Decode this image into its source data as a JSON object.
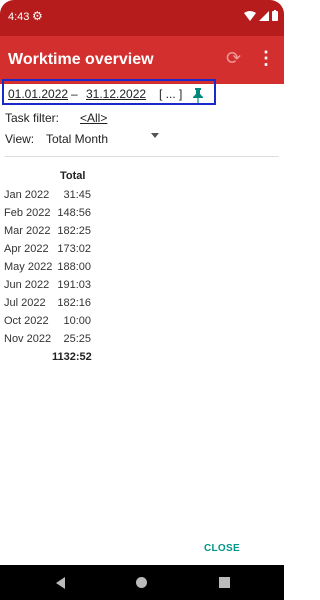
{
  "status": {
    "time": "4:43"
  },
  "appbar": {
    "title": "Worktime overview"
  },
  "date_range": {
    "from": "01.01.2022",
    "separator": "–",
    "to": "31.12.2022",
    "more": "[ ... ]"
  },
  "filter": {
    "label": "Task filter:",
    "value": "<All>"
  },
  "view": {
    "label": "View:",
    "value": "Total Month"
  },
  "table": {
    "header": "Total",
    "rows": [
      {
        "month": "Jan 2022",
        "value": "31:45"
      },
      {
        "month": "Feb 2022",
        "value": "148:56"
      },
      {
        "month": "Mar 2022",
        "value": "182:25"
      },
      {
        "month": "Apr 2022",
        "value": "173:02"
      },
      {
        "month": "May 2022",
        "value": "188:00"
      },
      {
        "month": "Jun 2022",
        "value": "191:03"
      },
      {
        "month": "Jul 2022",
        "value": "182:16"
      },
      {
        "month": "Oct 2022",
        "value": "10:00"
      },
      {
        "month": "Nov 2022",
        "value": "25:25"
      }
    ],
    "total": "1132:52"
  },
  "dialog": {
    "close_label": "CLOSE"
  },
  "colors": {
    "statusbar": "#b71c1c",
    "appbar": "#d32f2f",
    "accent": "#009688",
    "highlight_border": "#1a29c9"
  }
}
